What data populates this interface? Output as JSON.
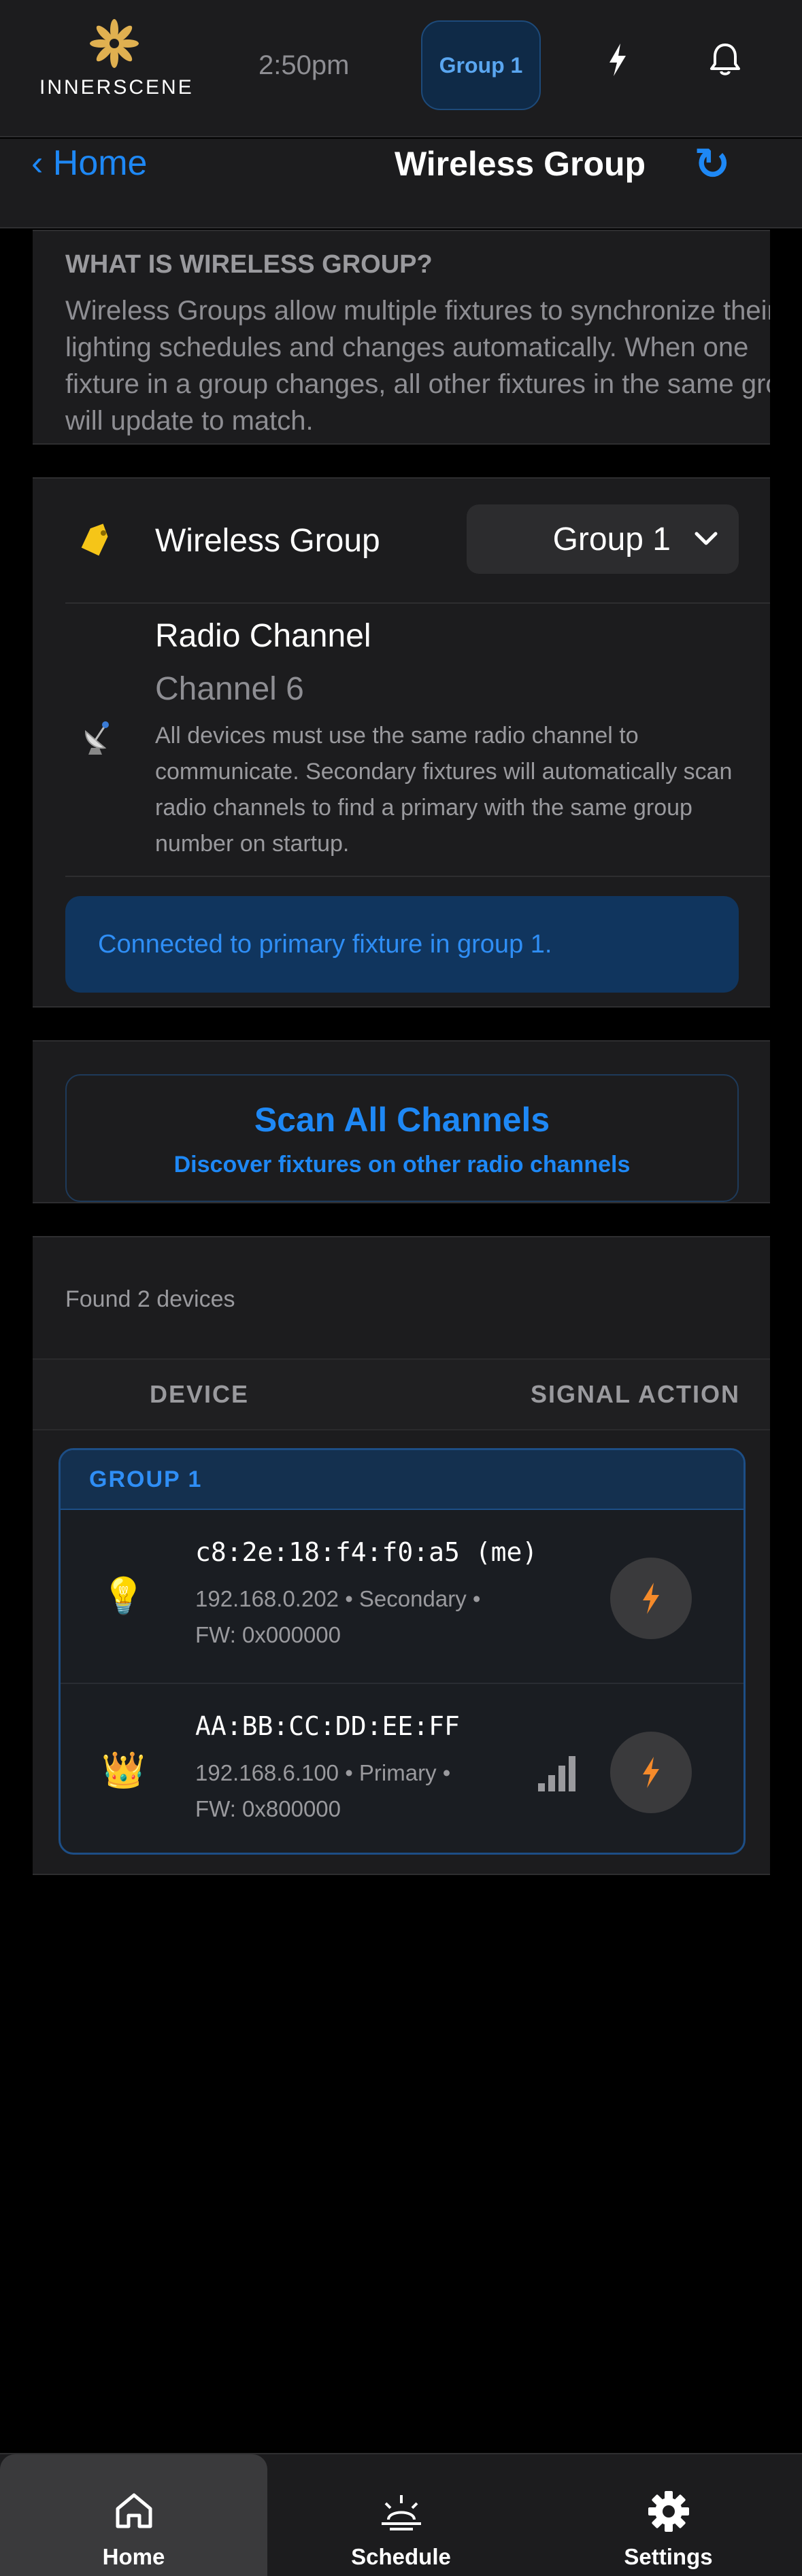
{
  "header": {
    "brand": "INNERSCENE",
    "time": "2:50pm",
    "group_badge": "Group 1",
    "icons": [
      "innerscene-logo",
      "flash-icon",
      "bell-icon"
    ]
  },
  "nav": {
    "back_label": "‹ Home",
    "title": "Wireless Group",
    "refresh_icon": "↻"
  },
  "info": {
    "heading": "WHAT IS WIRELESS GROUP?",
    "body": "Wireless Groups allow multiple fixtures to synchronize their lighting schedules and changes automatically. When one fixture in a group changes, all other fixtures in the same group will update to match."
  },
  "settings": {
    "group_label": "Wireless Group",
    "group_value": "Group 1",
    "channel_label": "Radio Channel",
    "channel_value": "Channel 6",
    "channel_desc": "All devices must use the same radio channel to communicate. Secondary fixtures will automatically scan radio channels to find a primary with the same group number on startup.",
    "status": "Connected to primary fixture in group 1."
  },
  "scan": {
    "title": "Scan All Channels",
    "subtitle": "Discover fixtures on other radio channels"
  },
  "devices": {
    "found_text": "Found 2 devices",
    "columns": [
      "DEVICE",
      "SIGNAL ACTION"
    ],
    "group_title": "GROUP 1",
    "items": [
      {
        "icon": "lightbulb-icon",
        "emoji": "💡",
        "mac": "c8:2e:18:f4:f0:a5 (me)",
        "ip_role": "192.168.0.202 • Secondary •",
        "fw": "FW: 0x000000"
      },
      {
        "icon": "crown-icon",
        "emoji": "👑",
        "mac": "AA:BB:CC:DD:EE:FF",
        "ip_role": "192.168.6.100 • Primary •",
        "fw": "FW: 0x800000",
        "signal_level": 4
      }
    ]
  },
  "tabs": [
    {
      "label": "Home",
      "active": true
    },
    {
      "label": "Schedule",
      "active": false
    },
    {
      "label": "Settings",
      "active": false
    }
  ],
  "colors": {
    "accent": "#1e88f5",
    "flash": "#f58a2a",
    "tag": "#f5c518"
  }
}
